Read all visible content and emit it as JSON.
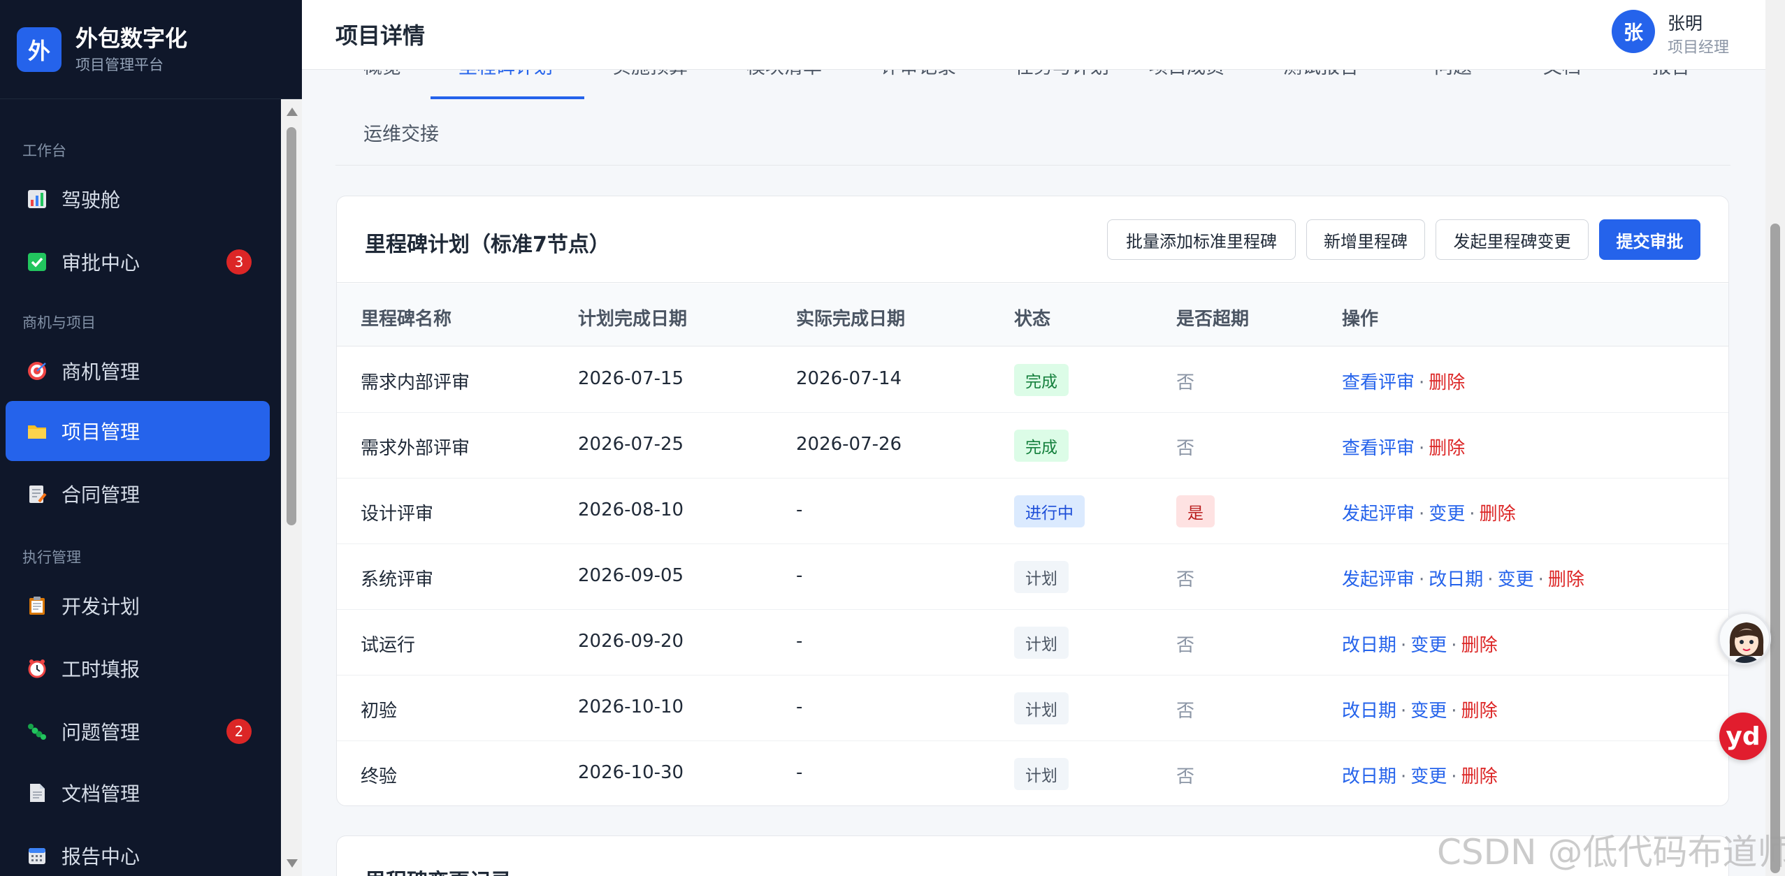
{
  "brand": {
    "logo_char": "外",
    "title": "外包数字化",
    "subtitle": "项目管理平台"
  },
  "sidebar": {
    "sections": [
      "工作台",
      "商机与项目",
      "执行管理"
    ],
    "items": [
      {
        "label": "驾驶舱",
        "icon": "chart-icon"
      },
      {
        "label": "审批中心",
        "icon": "check-icon",
        "badge": "3"
      },
      {
        "label": "商机管理",
        "icon": "target-icon"
      },
      {
        "label": "项目管理",
        "icon": "folder-icon",
        "active": true
      },
      {
        "label": "合同管理",
        "icon": "contract-icon"
      },
      {
        "label": "开发计划",
        "icon": "clipboard-icon"
      },
      {
        "label": "工时填报",
        "icon": "clock-icon"
      },
      {
        "label": "问题管理",
        "icon": "bug-icon",
        "badge": "2"
      },
      {
        "label": "文档管理",
        "icon": "document-icon"
      },
      {
        "label": "报告中心",
        "icon": "calendar-icon"
      }
    ]
  },
  "header": {
    "title": "项目详情",
    "user_avatar": "张",
    "user_name": "张明",
    "user_role": "项目经理"
  },
  "tabs": {
    "row1": [
      "概览",
      "里程碑计划",
      "实施预算",
      "模块清单",
      "评审记录",
      "任务与计划",
      "项目成员",
      "测试报告",
      "问题",
      "文档",
      "报告"
    ],
    "active": "里程碑计划",
    "row2": [
      "运维交接"
    ]
  },
  "milestones": {
    "title": "里程碑计划（标准7节点）",
    "buttons": {
      "batch_add": "批量添加标准里程碑",
      "add": "新增里程碑",
      "change": "发起里程碑变更",
      "submit": "提交审批"
    },
    "columns": [
      "里程碑名称",
      "计划完成日期",
      "实际完成日期",
      "状态",
      "是否超期",
      "操作"
    ],
    "rows": [
      {
        "name": "需求内部评审",
        "plan": "2026-07-15",
        "actual": "2026-07-14",
        "status": "完成",
        "status_type": "done",
        "overdue": "否",
        "actions": [
          "查看评审",
          "删除"
        ]
      },
      {
        "name": "需求外部评审",
        "plan": "2026-07-25",
        "actual": "2026-07-26",
        "status": "完成",
        "status_type": "done",
        "overdue": "否",
        "actions": [
          "查看评审",
          "删除"
        ]
      },
      {
        "name": "设计评审",
        "plan": "2026-08-10",
        "actual": "-",
        "status": "进行中",
        "status_type": "doing",
        "overdue": "是",
        "actions": [
          "发起评审",
          "变更",
          "删除"
        ]
      },
      {
        "name": "系统评审",
        "plan": "2026-09-05",
        "actual": "-",
        "status": "计划",
        "status_type": "plan",
        "overdue": "否",
        "actions": [
          "发起评审",
          "改日期",
          "变更",
          "删除"
        ]
      },
      {
        "name": "试运行",
        "plan": "2026-09-20",
        "actual": "-",
        "status": "计划",
        "status_type": "plan",
        "overdue": "否",
        "actions": [
          "改日期",
          "变更",
          "删除"
        ]
      },
      {
        "name": "初验",
        "plan": "2026-10-10",
        "actual": "-",
        "status": "计划",
        "status_type": "plan",
        "overdue": "否",
        "actions": [
          "改日期",
          "变更",
          "删除"
        ]
      },
      {
        "name": "终验",
        "plan": "2026-10-30",
        "actual": "-",
        "status": "计划",
        "status_type": "plan",
        "overdue": "否",
        "actions": [
          "改日期",
          "变更",
          "删除"
        ]
      }
    ]
  },
  "change_log": {
    "title": "里程碑变更记录"
  },
  "floating": {
    "yd_label": "yd"
  },
  "watermark": "CSDN @低代码布道师",
  "colors": {
    "primary": "#2563eb",
    "sidebar_bg": "#0f172a",
    "danger": "#dc2626",
    "success": "#15803d"
  }
}
